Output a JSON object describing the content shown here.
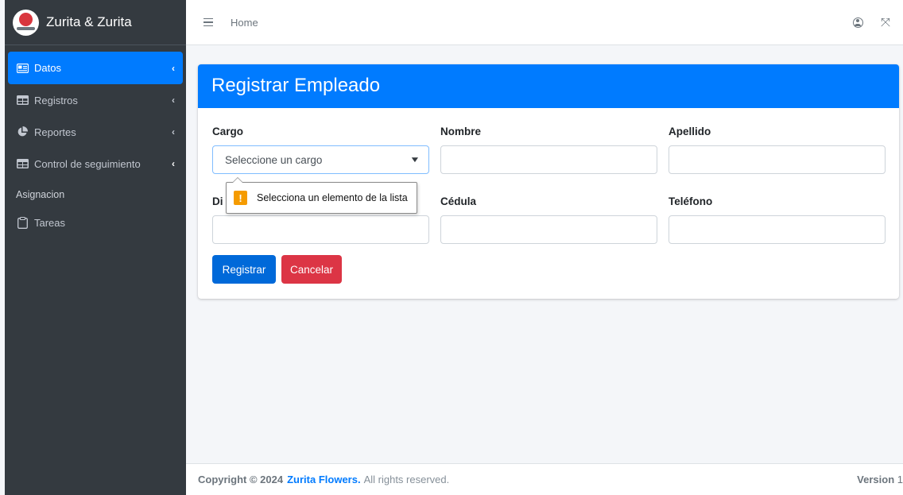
{
  "brand": {
    "name": "Zurita & Zurita"
  },
  "sidebar": {
    "items": [
      {
        "label": "Datos",
        "icon": "id-card-icon",
        "active": true
      },
      {
        "label": "Registros",
        "icon": "table-icon"
      },
      {
        "label": "Reportes",
        "icon": "pie-chart-icon"
      },
      {
        "label": "Control de seguimiento",
        "icon": "table-icon"
      }
    ],
    "header": "Asignacion",
    "extra_items": [
      {
        "label": "Tareas",
        "icon": "clipboard-icon"
      }
    ]
  },
  "topbar": {
    "home_label": "Home"
  },
  "form": {
    "title": "Registrar Empleado",
    "cargo": {
      "label": "Cargo",
      "selected": "Seleccione un cargo"
    },
    "nombre": {
      "label": "Nombre",
      "value": ""
    },
    "apellido": {
      "label": "Apellido",
      "value": ""
    },
    "direccion": {
      "label": "Di",
      "value": ""
    },
    "cedula": {
      "label": "Cédula",
      "value": ""
    },
    "telefono": {
      "label": "Teléfono",
      "value": ""
    },
    "submit_label": "Registrar",
    "cancel_label": "Cancelar"
  },
  "validation": {
    "message": "Selecciona un elemento de la lista"
  },
  "footer": {
    "copyright_prefix": "Copyright © 2024",
    "company": "Zurita Flowers.",
    "rights": "All rights reserved.",
    "version_label": "Version",
    "version_number": "1"
  },
  "colors": {
    "primary": "#007bff",
    "danger": "#dc3545",
    "sidebar": "#343a40",
    "warning": "#f59b00"
  }
}
